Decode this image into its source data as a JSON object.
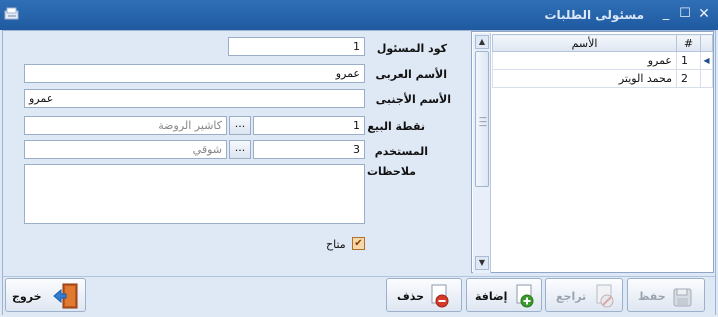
{
  "window": {
    "title": "مسئولى الطلبات",
    "controls": {
      "close": "✕",
      "maximize": "☐",
      "minimize": "_"
    }
  },
  "form": {
    "code_label": "كود المسئول",
    "code_value": "1",
    "arabic_name_label": "الأسم العربى",
    "arabic_name_value": "عمرو",
    "foreign_name_label": "الأسم الأجنبى",
    "foreign_name_value": "عمرو",
    "pos_label": "نقطة البيع",
    "pos_code": "1",
    "pos_name": "كاشير الروضة",
    "user_label": "المستخدم",
    "user_code": "3",
    "user_name": "شوقي",
    "notes_label": "ملاحظات",
    "available_label": "متاح",
    "available_checked": true,
    "browse_label": "..."
  },
  "grid": {
    "columns": [
      "#",
      "الأسم"
    ],
    "rows": [
      {
        "num": "1",
        "name": "عمرو",
        "selected": true
      },
      {
        "num": "2",
        "name": "محمد الويتر",
        "selected": false
      }
    ]
  },
  "toolbar": {
    "save_label": "حفظ",
    "undo_label": "تراجع",
    "add_label": "إضافة",
    "delete_label": "حذف",
    "exit_label": "خروج"
  },
  "colors": {
    "titlebar": "#2f6fb6",
    "background": "#dfe8f5",
    "add_icon": "#3a9a2c",
    "delete_icon": "#d23a2a",
    "exit_door": "#c2561a"
  }
}
